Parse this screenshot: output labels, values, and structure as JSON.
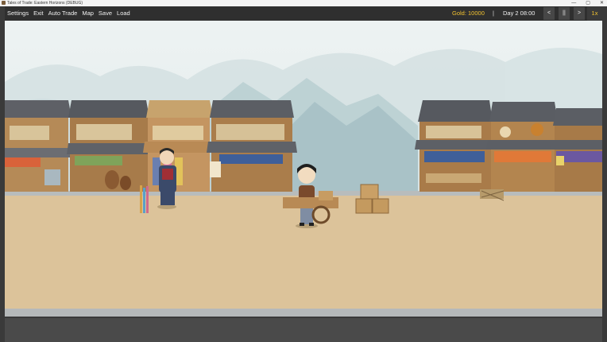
{
  "window": {
    "title": "Tales of Trade: Eastern Horizons (DEBUG)",
    "min_glyph": "—",
    "max_glyph": "▢",
    "close_glyph": "✕"
  },
  "menu": {
    "settings": "Settings",
    "exit": "Exit",
    "auto_trade": "Auto Trade",
    "map": "Map",
    "save": "Save",
    "load": "Load"
  },
  "status": {
    "gold": "Gold: 10000",
    "separator": "|",
    "day": "Day 2 08:00"
  },
  "controls": {
    "prev": "<",
    "pause": "||",
    "next": ">",
    "speed": "1x"
  },
  "colors": {
    "gold_text": "#f2c230",
    "topbar_bg": "#2f2f2f",
    "ground": "#dcc39a",
    "sky": "#e8eff0"
  },
  "icons": [
    "app-icon",
    "minimize-icon",
    "maximize-icon",
    "close-icon"
  ]
}
